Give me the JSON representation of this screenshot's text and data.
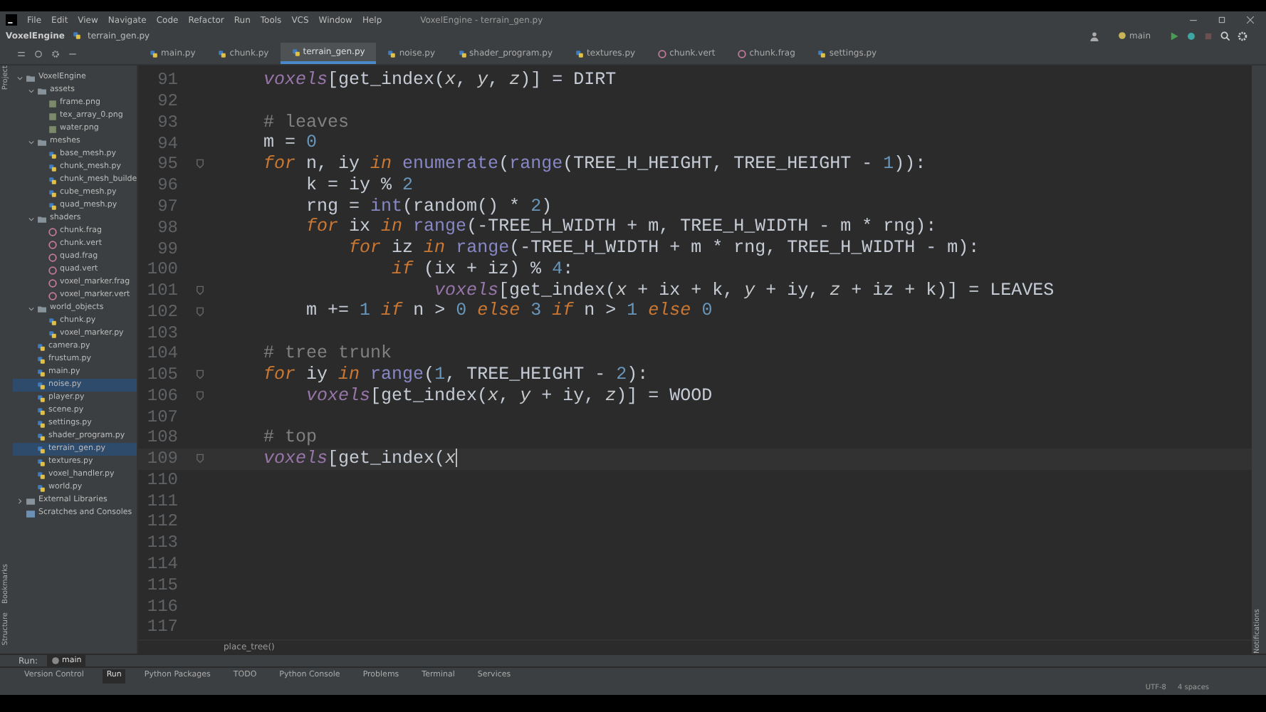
{
  "menu": [
    "File",
    "Edit",
    "View",
    "Navigate",
    "Code",
    "Refactor",
    "Run",
    "Tools",
    "VCS",
    "Window",
    "Help"
  ],
  "window": {
    "title": "VoxelEngine - terrain_gen.py"
  },
  "breadcrumb": [
    "VoxelEngine",
    "terrain_gen.py"
  ],
  "branch": "main",
  "tabs": [
    {
      "label": "main.py",
      "kind": "py",
      "selected": false
    },
    {
      "label": "chunk.py",
      "kind": "py",
      "selected": false
    },
    {
      "label": "terrain_gen.py",
      "kind": "py",
      "selected": true
    },
    {
      "label": "noise.py",
      "kind": "py",
      "selected": false
    },
    {
      "label": "shader_program.py",
      "kind": "py",
      "selected": false
    },
    {
      "label": "textures.py",
      "kind": "py",
      "selected": false
    },
    {
      "label": "chunk.vert",
      "kind": "shader",
      "selected": false
    },
    {
      "label": "chunk.frag",
      "kind": "shader",
      "selected": false
    },
    {
      "label": "settings.py",
      "kind": "py",
      "selected": false
    }
  ],
  "side_labels": {
    "left_top": "Project",
    "left_bottom": [
      "Bookmarks",
      "Structure"
    ],
    "right": "Notifications"
  },
  "project_tree": [
    {
      "label": "VoxelEngine",
      "kind": "folder",
      "expanded": true,
      "selected": false,
      "children": [
        {
          "label": "assets",
          "kind": "folder",
          "expanded": true,
          "selected": false,
          "children": [
            {
              "label": "frame.png",
              "kind": "image",
              "selected": false
            },
            {
              "label": "tex_array_0.png",
              "kind": "image",
              "selected": false
            },
            {
              "label": "water.png",
              "kind": "image",
              "selected": false
            }
          ]
        },
        {
          "label": "meshes",
          "kind": "folder",
          "expanded": true,
          "selected": false,
          "children": [
            {
              "label": "base_mesh.py",
              "kind": "py",
              "selected": false
            },
            {
              "label": "chunk_mesh.py",
              "kind": "py",
              "selected": false
            },
            {
              "label": "chunk_mesh_builde",
              "kind": "py",
              "selected": false
            },
            {
              "label": "cube_mesh.py",
              "kind": "py",
              "selected": false
            },
            {
              "label": "quad_mesh.py",
              "kind": "py",
              "selected": false
            }
          ]
        },
        {
          "label": "shaders",
          "kind": "folder",
          "expanded": true,
          "selected": false,
          "children": [
            {
              "label": "chunk.frag",
              "kind": "shader",
              "selected": false
            },
            {
              "label": "chunk.vert",
              "kind": "shader",
              "selected": false
            },
            {
              "label": "quad.frag",
              "kind": "shader",
              "selected": false
            },
            {
              "label": "quad.vert",
              "kind": "shader",
              "selected": false
            },
            {
              "label": "voxel_marker.frag",
              "kind": "shader",
              "selected": false
            },
            {
              "label": "voxel_marker.vert",
              "kind": "shader",
              "selected": false
            }
          ]
        },
        {
          "label": "world_objects",
          "kind": "folder",
          "expanded": true,
          "selected": false,
          "children": [
            {
              "label": "chunk.py",
              "kind": "py",
              "selected": false
            },
            {
              "label": "voxel_marker.py",
              "kind": "py",
              "selected": false
            }
          ]
        },
        {
          "label": "camera.py",
          "kind": "py",
          "selected": false
        },
        {
          "label": "frustum.py",
          "kind": "py",
          "selected": false
        },
        {
          "label": "main.py",
          "kind": "py",
          "selected": false
        },
        {
          "label": "noise.py",
          "kind": "py",
          "selected": true
        },
        {
          "label": "player.py",
          "kind": "py",
          "selected": false
        },
        {
          "label": "scene.py",
          "kind": "py",
          "selected": false
        },
        {
          "label": "settings.py",
          "kind": "py",
          "selected": false
        },
        {
          "label": "shader_program.py",
          "kind": "py",
          "selected": false
        },
        {
          "label": "terrain_gen.py",
          "kind": "py",
          "selected": true
        },
        {
          "label": "textures.py",
          "kind": "py",
          "selected": false
        },
        {
          "label": "voxel_handler.py",
          "kind": "py",
          "selected": false
        },
        {
          "label": "world.py",
          "kind": "py",
          "selected": false
        }
      ]
    },
    {
      "label": "External Libraries",
      "kind": "library",
      "expanded": false,
      "selected": false
    },
    {
      "label": "Scratches and Consoles",
      "kind": "scratch",
      "selected": false
    }
  ],
  "editor": {
    "lines": [
      {
        "number": "91",
        "tokens": [
          {
            "kind": "glob",
            "text": "    voxels"
          },
          {
            "kind": "plain",
            "text": "[get_index("
          },
          {
            "kind": "param",
            "text": "x"
          },
          {
            "kind": "plain",
            "text": ", "
          },
          {
            "kind": "param",
            "text": "y"
          },
          {
            "kind": "plain",
            "text": ", "
          },
          {
            "kind": "param",
            "text": "z"
          },
          {
            "kind": "plain",
            "text": ")] = DIRT"
          }
        ]
      },
      {
        "number": "92"
      },
      {
        "number": "93",
        "tokens": [
          {
            "kind": "comment",
            "text": "    # leaves"
          }
        ]
      },
      {
        "number": "94",
        "tokens": [
          {
            "kind": "plain",
            "text": "    m = "
          },
          {
            "kind": "num",
            "text": "0"
          }
        ]
      },
      {
        "number": "95",
        "fold": true,
        "tokens": [
          {
            "kind": "kw",
            "text": "    for"
          },
          {
            "kind": "plain",
            "text": " n, iy "
          },
          {
            "kind": "kw",
            "text": "in"
          },
          {
            "kind": "builtin",
            "text": " enumerate"
          },
          {
            "kind": "plain",
            "text": "("
          },
          {
            "kind": "builtin",
            "text": "range"
          },
          {
            "kind": "plain",
            "text": "(TREE_H_HEIGHT, TREE_HEIGHT - "
          },
          {
            "kind": "num",
            "text": "1"
          },
          {
            "kind": "plain",
            "text": ")):"
          }
        ]
      },
      {
        "number": "96",
        "tokens": [
          {
            "kind": "plain",
            "text": "        k = iy % "
          },
          {
            "kind": "num",
            "text": "2"
          }
        ]
      },
      {
        "number": "97",
        "tokens": [
          {
            "kind": "plain",
            "text": "        rng = "
          },
          {
            "kind": "builtin",
            "text": "int"
          },
          {
            "kind": "plain",
            "text": "(random() * "
          },
          {
            "kind": "num",
            "text": "2"
          },
          {
            "kind": "plain",
            "text": ")"
          }
        ]
      },
      {
        "number": "98",
        "tokens": [
          {
            "kind": "kw",
            "text": "        for"
          },
          {
            "kind": "plain",
            "text": " ix "
          },
          {
            "kind": "kw",
            "text": "in"
          },
          {
            "kind": "builtin",
            "text": " range"
          },
          {
            "kind": "plain",
            "text": "(-TREE_H_WIDTH + m, TREE_H_WIDTH - m * rng):"
          }
        ]
      },
      {
        "number": "99",
        "tokens": [
          {
            "kind": "kw",
            "text": "            for"
          },
          {
            "kind": "plain",
            "text": " iz "
          },
          {
            "kind": "kw",
            "text": "in"
          },
          {
            "kind": "builtin",
            "text": " range"
          },
          {
            "kind": "plain",
            "text": "(-TREE_H_WIDTH + m * rng, TREE_H_WIDTH - m):"
          }
        ]
      },
      {
        "number": "100",
        "tokens": [
          {
            "kind": "kw",
            "text": "                if"
          },
          {
            "kind": "plain",
            "text": " (ix + iz) % "
          },
          {
            "kind": "num",
            "text": "4"
          },
          {
            "kind": "plain",
            "text": ":"
          }
        ]
      },
      {
        "number": "101",
        "fold": true,
        "tokens": [
          {
            "kind": "glob",
            "text": "                    voxels"
          },
          {
            "kind": "plain",
            "text": "[get_index("
          },
          {
            "kind": "param",
            "text": "x"
          },
          {
            "kind": "plain",
            "text": " + ix + k, "
          },
          {
            "kind": "param",
            "text": "y"
          },
          {
            "kind": "plain",
            "text": " + iy, "
          },
          {
            "kind": "param",
            "text": "z"
          },
          {
            "kind": "plain",
            "text": " + iz + k)] = LEAVES"
          }
        ]
      },
      {
        "number": "102",
        "fold": true,
        "tokens": [
          {
            "kind": "plain",
            "text": "        m += "
          },
          {
            "kind": "num",
            "text": "1"
          },
          {
            "kind": "kw",
            "text": " if"
          },
          {
            "kind": "plain",
            "text": " n > "
          },
          {
            "kind": "num",
            "text": "0"
          },
          {
            "kind": "kw",
            "text": " else"
          },
          {
            "kind": "num",
            "text": " 3"
          },
          {
            "kind": "kw",
            "text": " if"
          },
          {
            "kind": "plain",
            "text": " n > "
          },
          {
            "kind": "num",
            "text": "1"
          },
          {
            "kind": "kw",
            "text": " else"
          },
          {
            "kind": "num",
            "text": " 0"
          }
        ]
      },
      {
        "number": "103"
      },
      {
        "number": "104",
        "tokens": [
          {
            "kind": "comment",
            "text": "    # tree trunk"
          }
        ]
      },
      {
        "number": "105",
        "fold": true,
        "tokens": [
          {
            "kind": "kw",
            "text": "    for"
          },
          {
            "kind": "plain",
            "text": " iy "
          },
          {
            "kind": "kw",
            "text": "in"
          },
          {
            "kind": "builtin",
            "text": " range"
          },
          {
            "kind": "plain",
            "text": "("
          },
          {
            "kind": "num",
            "text": "1"
          },
          {
            "kind": "plain",
            "text": ", TREE_HEIGHT - "
          },
          {
            "kind": "num",
            "text": "2"
          },
          {
            "kind": "plain",
            "text": "):"
          }
        ]
      },
      {
        "number": "106",
        "fold": true,
        "tokens": [
          {
            "kind": "glob",
            "text": "        voxels"
          },
          {
            "kind": "plain",
            "text": "[get_index("
          },
          {
            "kind": "param",
            "text": "x"
          },
          {
            "kind": "plain",
            "text": ", "
          },
          {
            "kind": "param",
            "text": "y"
          },
          {
            "kind": "plain",
            "text": " + iy, "
          },
          {
            "kind": "param",
            "text": "z"
          },
          {
            "kind": "plain",
            "text": ")] = WOOD"
          }
        ]
      },
      {
        "number": "107"
      },
      {
        "number": "108",
        "tokens": [
          {
            "kind": "comment",
            "text": "    # top"
          }
        ]
      },
      {
        "number": "109",
        "current": true,
        "fold": true,
        "tokens": [
          {
            "kind": "glob",
            "text": "    voxels"
          },
          {
            "kind": "plain",
            "text": "[get_index("
          },
          {
            "kind": "param",
            "text": "x"
          }
        ]
      },
      {
        "number": "110"
      },
      {
        "number": "111"
      },
      {
        "number": "112"
      },
      {
        "number": "113"
      },
      {
        "number": "114"
      },
      {
        "number": "115"
      },
      {
        "number": "116"
      },
      {
        "number": "117"
      }
    ],
    "scope": "place_tree()"
  },
  "run_bar": {
    "label": "Run:",
    "config": "main"
  },
  "tool_windows": [
    {
      "label": "Version Control",
      "selected": false
    },
    {
      "label": "Run",
      "selected": true
    },
    {
      "label": "Python Packages",
      "selected": false
    },
    {
      "label": "TODO",
      "selected": false
    },
    {
      "label": "Python Console",
      "selected": false
    },
    {
      "label": "Problems",
      "selected": false
    },
    {
      "label": "Terminal",
      "selected": false
    },
    {
      "label": "Services",
      "selected": false
    }
  ],
  "status_bar": [
    "UTF-8",
    "4 spaces"
  ]
}
